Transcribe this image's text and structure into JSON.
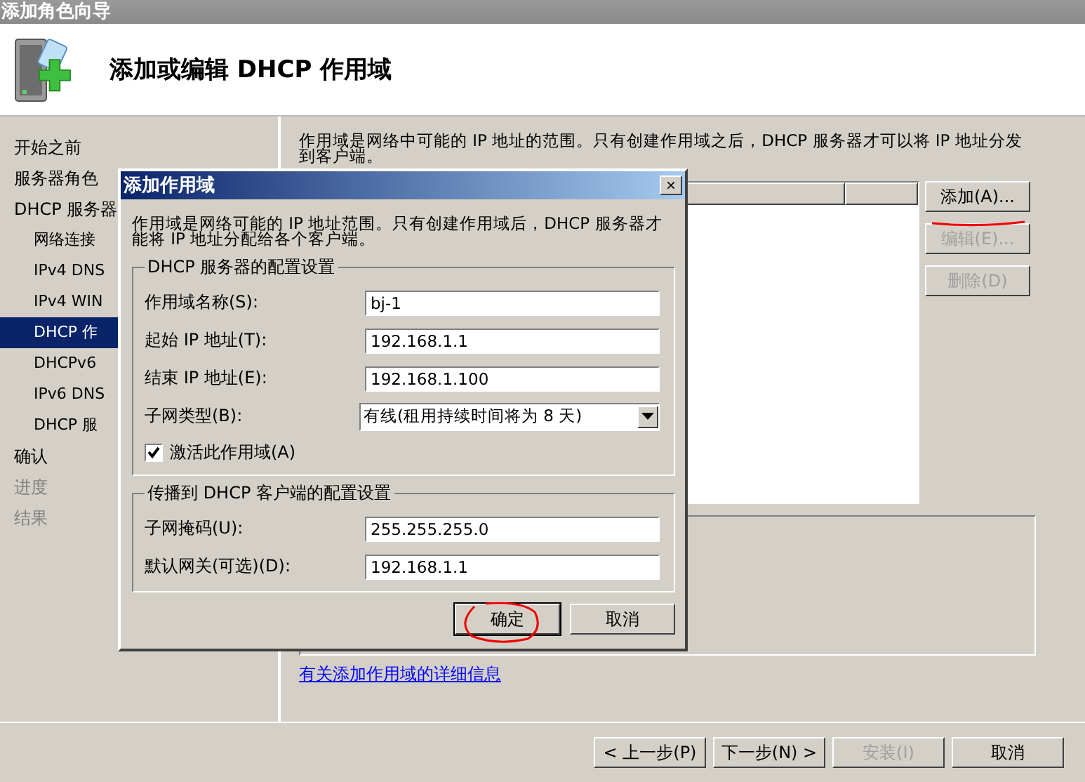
{
  "window": {
    "title": "添加角色向导"
  },
  "header": {
    "title": "添加或编辑 DHCP 作用域"
  },
  "sidebar": {
    "items": [
      {
        "label": "开始之前",
        "selected": false,
        "disabled": false
      },
      {
        "label": "服务器角色",
        "selected": false,
        "disabled": false
      },
      {
        "label": "DHCP 服务器",
        "selected": false,
        "disabled": false,
        "children": [
          {
            "label": "网络连接",
            "selected": false,
            "disabled": false
          },
          {
            "label": "IPv4 DNS",
            "selected": false,
            "disabled": false
          },
          {
            "label": "IPv4 WIN",
            "selected": false,
            "disabled": false
          },
          {
            "label": "DHCP 作",
            "selected": true,
            "disabled": false
          },
          {
            "label": "DHCPv6",
            "selected": false,
            "disabled": false
          },
          {
            "label": "IPv6 DNS",
            "selected": false,
            "disabled": false
          },
          {
            "label": "DHCP 服",
            "selected": false,
            "disabled": false
          }
        ]
      },
      {
        "label": "确认",
        "selected": false,
        "disabled": false
      },
      {
        "label": "进度",
        "selected": false,
        "disabled": true
      },
      {
        "label": "结果",
        "selected": false,
        "disabled": true
      }
    ]
  },
  "content": {
    "description": "作用域是网络中可能的 IP 地址的范围。只有创建作用域之后，DHCP 服务器才可以将 IP 地址分发到客户端。",
    "list_buttons": [
      {
        "label": "添加(A)...",
        "disabled": false
      },
      {
        "label": "编辑(E)...",
        "disabled": true
      },
      {
        "label": "删除(D)",
        "disabled": true
      }
    ],
    "link": "有关添加作用域的详细信息"
  },
  "footer": {
    "buttons": [
      {
        "label": "< 上一步(P)",
        "disabled": false
      },
      {
        "label": "下一步(N) >",
        "disabled": false
      },
      {
        "label": "安装(I)",
        "disabled": true
      },
      {
        "label": "取消",
        "disabled": false
      }
    ]
  },
  "dialog": {
    "title": "添加作用域",
    "close": "×",
    "description": "作用域是网络可能的 IP 地址范围。只有创建作用域后，DHCP 服务器才能将 IP 地址分配给各个客户端。",
    "groups": [
      {
        "legend": "DHCP 服务器的配置设置",
        "fields": [
          {
            "kind": "text",
            "label": "作用域名称(S):",
            "value": "bj-1"
          },
          {
            "kind": "text",
            "label": "起始 IP 地址(T):",
            "value": "192.168.1.1"
          },
          {
            "kind": "text",
            "label": "结束 IP 地址(E):",
            "value": "192.168.1.100"
          },
          {
            "kind": "select",
            "label": "子网类型(B):",
            "value": "有线(租用持续时间将为 8 天)"
          },
          {
            "kind": "checkbox",
            "label": "激活此作用域(A)",
            "checked": true
          }
        ]
      },
      {
        "legend": "传播到 DHCP 客户端的配置设置",
        "fields": [
          {
            "kind": "text",
            "label": "子网掩码(U):",
            "value": "255.255.255.0"
          },
          {
            "kind": "text",
            "label": "默认网关(可选)(D):",
            "value": "192.168.1.1"
          }
        ]
      }
    ],
    "buttons": [
      {
        "label": "确定",
        "default": true
      },
      {
        "label": "取消",
        "default": false
      }
    ]
  }
}
